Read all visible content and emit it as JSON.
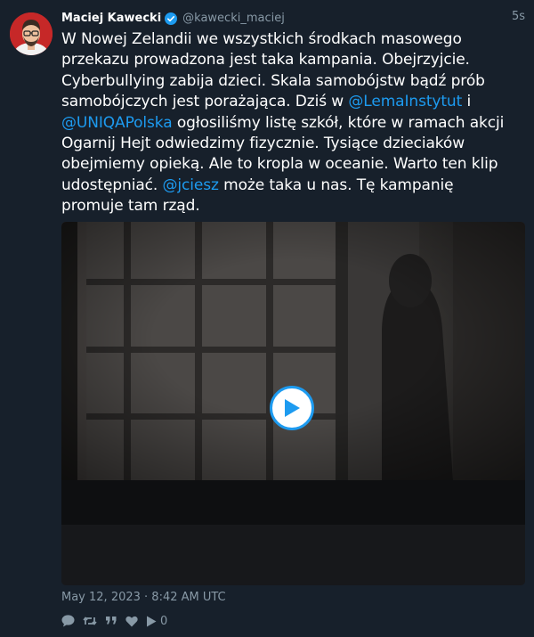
{
  "author": {
    "name": "Maciej Kawecki",
    "handle": "@kawecki_maciej",
    "verified": true
  },
  "timestamp_relative": "5s",
  "tweet": {
    "segments": [
      {
        "type": "text",
        "text": "W Nowej Zelandii we wszystkich środkach masowego przekazu prowadzona jest taka kampania. Obejrzyjcie. Cyberbullying zabija dzieci. Skala samobójstw bądź prób samobójczych jest porażająca. Dziś w "
      },
      {
        "type": "mention",
        "text": "@LemaInstytut"
      },
      {
        "type": "text",
        "text": " i "
      },
      {
        "type": "mention",
        "text": "@UNIQAPolska"
      },
      {
        "type": "text",
        "text": " ogłosiliśmy listę szkół, które w ramach akcji Ogarnij Hejt odwiedzimy fizycznie. Tysiące dzieciaków obejmiemy opieką. Ale to kropla w oceanie. Warto ten klip udostępniać. "
      },
      {
        "type": "mention",
        "text": "@jciesz"
      },
      {
        "type": "text",
        "text": " może taka u nas. Tę kampanię promuje tam rząd."
      }
    ]
  },
  "media": {
    "kind": "video",
    "play_icon": "play-icon"
  },
  "date": "May 12, 2023 · 8:42 AM UTC",
  "actions": {
    "reply_icon": "reply-icon",
    "retweet_icon": "retweet-icon",
    "quote_icon": "quote-icon",
    "like_icon": "heart-icon",
    "views_icon": "play-icon",
    "views_count": "0"
  },
  "colors": {
    "background": "#17202b",
    "accent": "#1d9bf0",
    "muted": "#8899a6"
  }
}
